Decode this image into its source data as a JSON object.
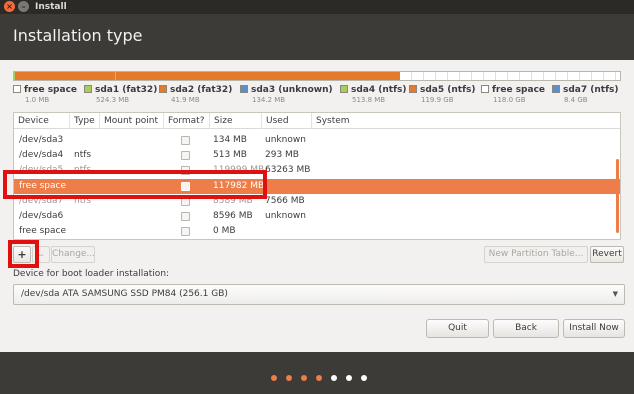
{
  "window": {
    "title": "Install",
    "close_glyph": "×",
    "min_glyph": "–"
  },
  "header": {
    "title": "Installation type"
  },
  "colors": {
    "accent": "#ed7e4a",
    "fat32": "#a5cf5a",
    "partition": "#e47a2c",
    "unknown": "#5a8fc8",
    "ntfs": "#a5cf5a",
    "free": "#ffffff"
  },
  "partition_bar": {
    "segments": [
      {
        "label": "sda1",
        "fraction": 0.002
      },
      {
        "label": "sda2",
        "fraction": 0.164
      },
      {
        "label": "sda3",
        "fraction": 0.001
      },
      {
        "label": "sda4",
        "fraction": 0.002
      },
      {
        "label": "sda5",
        "fraction": 0.468
      },
      {
        "label": "free space",
        "fraction": 0.46
      },
      {
        "label": "sda7",
        "fraction": 0.033
      }
    ]
  },
  "legend": [
    {
      "name": "free space",
      "size": "1.0 MB",
      "color": "#ffffff"
    },
    {
      "name": "sda1 (fat32)",
      "size": "524.3 MB",
      "color": "#a5cf5a"
    },
    {
      "name": "sda2 (fat32)",
      "size": "41.9 MB",
      "color": "#e47a2c"
    },
    {
      "name": "sda3 (unknown)",
      "size": "134.2 MB",
      "color": "#5a8fc8"
    },
    {
      "name": "sda4 (ntfs)",
      "size": "513.8 MB",
      "color": "#a5cf5a"
    },
    {
      "name": "sda5 (ntfs)",
      "size": "119.9 GB",
      "color": "#e47a2c"
    },
    {
      "name": "free space",
      "size": "118.0 GB",
      "color": "#ffffff"
    },
    {
      "name": "sda7 (ntfs)",
      "size": "8.4 GB",
      "color": "#5a8fc8"
    }
  ],
  "table": {
    "headers": [
      "Device",
      "Type",
      "Mount point",
      "Format?",
      "Size",
      "Used",
      "System"
    ],
    "rows": [
      {
        "device": "/dev/sda3",
        "type": "",
        "mount": "",
        "size": "134 MB",
        "used": "unknown"
      },
      {
        "device": "/dev/sda4",
        "type": "ntfs",
        "mount": "",
        "size": "513 MB",
        "used": "293 MB"
      },
      {
        "device": "/dev/sda5",
        "type": "ntfs",
        "mount": "",
        "size": "119999 MB",
        "used": "63263 MB"
      },
      {
        "device": "free space",
        "type": "",
        "mount": "",
        "size": "117982 MB",
        "used": ""
      },
      {
        "device": "/dev/sda7",
        "type": "ntfs",
        "mount": "",
        "size": "8589 MB",
        "used": "7566 MB"
      },
      {
        "device": "/dev/sda6",
        "type": "",
        "mount": "",
        "size": "8596 MB",
        "used": "unknown"
      },
      {
        "device": "free space",
        "type": "",
        "mount": "",
        "size": "0 MB",
        "used": ""
      }
    ],
    "selected_index": 3
  },
  "toolbar": {
    "add": "+",
    "remove": "–",
    "change": "Change...",
    "new_table": "New Partition Table...",
    "revert": "Revert"
  },
  "boot": {
    "label": "Device for boot loader installation:",
    "value": "/dev/sda   ATA SAMSUNG SSD PM84 (256.1 GB)",
    "arrow": "▼"
  },
  "buttons": {
    "quit": "Quit",
    "back": "Back",
    "install": "Install Now"
  },
  "progress": {
    "steps_done": 4,
    "steps_total": 7
  }
}
